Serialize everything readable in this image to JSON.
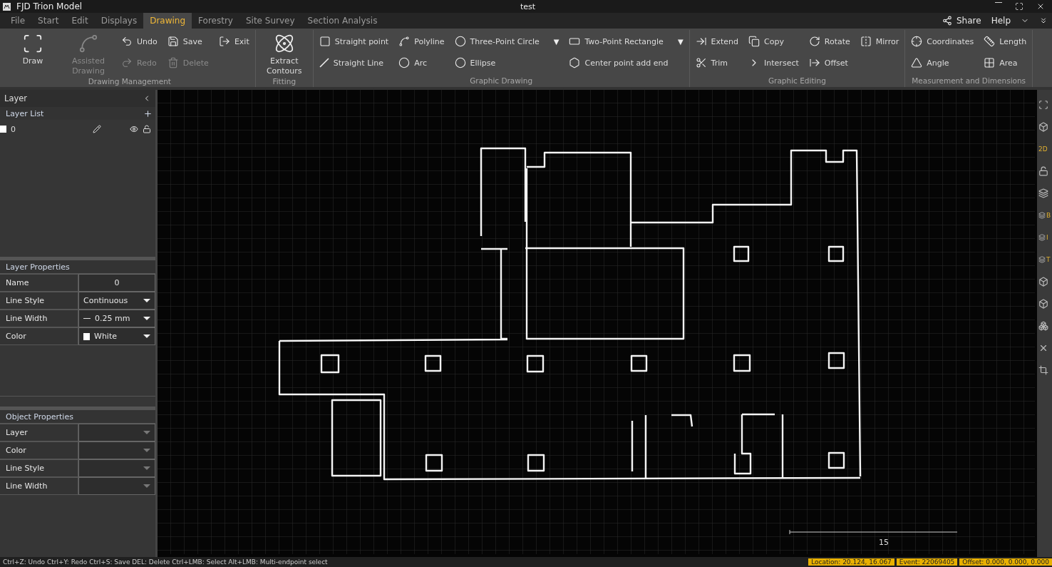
{
  "window": {
    "title": "FJD Trion Model",
    "document": "test"
  },
  "menu_tabs": [
    {
      "label": "File",
      "selected": false
    },
    {
      "label": "Start",
      "selected": false
    },
    {
      "label": "Edit",
      "selected": false
    },
    {
      "label": "Displays",
      "selected": false
    },
    {
      "label": "Drawing",
      "selected": true
    },
    {
      "label": "Forestry",
      "selected": false
    },
    {
      "label": "Site Survey",
      "selected": false
    },
    {
      "label": "Section Analysis",
      "selected": false
    }
  ],
  "top_right": {
    "share": "Share",
    "help": "Help"
  },
  "ribbon": [
    {
      "label": "Drawing Management",
      "columns": [
        [
          {
            "label": "Draw",
            "kind": "large",
            "disabled": false
          }
        ],
        [
          {
            "label": "Assisted Drawing",
            "kind": "large",
            "disabled": true
          }
        ],
        [
          {
            "label": "Undo",
            "kind": "small",
            "disabled": false
          },
          {
            "label": "Redo",
            "kind": "small",
            "disabled": true
          }
        ],
        [
          {
            "label": "Save",
            "kind": "small",
            "disabled": false
          },
          {
            "label": "Delete",
            "kind": "small",
            "disabled": true
          }
        ],
        [
          {
            "label": "Exit",
            "kind": "small",
            "disabled": false
          }
        ]
      ]
    },
    {
      "label": "Fitting",
      "columns": [
        [
          {
            "label": "Extract Contours",
            "kind": "large",
            "disabled": false
          }
        ]
      ]
    },
    {
      "label": "Graphic Drawing",
      "columns": [
        [
          {
            "label": "Straight point",
            "kind": "small",
            "disabled": false
          },
          {
            "label": "Straight Line",
            "kind": "small",
            "disabled": false
          }
        ],
        [
          {
            "label": "Polyline",
            "kind": "small",
            "disabled": false
          },
          {
            "label": "Arc",
            "kind": "small",
            "disabled": false
          }
        ],
        [
          {
            "label": "Three-Point Circle",
            "kind": "small",
            "disabled": false,
            "dropdown": "▼"
          },
          {
            "label": "Ellipse",
            "kind": "small",
            "disabled": false
          }
        ],
        [
          {
            "label": "Two-Point Rectangle",
            "kind": "small",
            "disabled": false,
            "dropdown": "▼"
          },
          {
            "label": "Center point add end",
            "kind": "small",
            "disabled": false
          }
        ]
      ]
    },
    {
      "label": "Graphic Editing",
      "columns": [
        [
          {
            "label": "Extend",
            "kind": "small",
            "disabled": false
          },
          {
            "label": "Trim",
            "kind": "small",
            "disabled": false
          }
        ],
        [
          {
            "label": "Copy",
            "kind": "small",
            "disabled": false
          },
          {
            "label": "Intersect",
            "kind": "small",
            "disabled": false
          }
        ],
        [
          {
            "label": "Rotate",
            "kind": "small",
            "disabled": false
          },
          {
            "label": "Offset",
            "kind": "small",
            "disabled": false
          }
        ],
        [
          {
            "label": "Mirror",
            "kind": "small",
            "disabled": false
          }
        ]
      ]
    },
    {
      "label": "Measurement and Dimensions",
      "columns": [
        [
          {
            "label": "Coordinates",
            "kind": "small",
            "disabled": false
          },
          {
            "label": "Angle",
            "kind": "small",
            "disabled": false
          }
        ],
        [
          {
            "label": "Length",
            "kind": "small",
            "disabled": false
          },
          {
            "label": "Area",
            "kind": "small",
            "disabled": false
          }
        ]
      ]
    }
  ],
  "layer_panel": {
    "title": "Layer",
    "list_title": "Layer List",
    "layers": [
      {
        "name": "0",
        "visible": true,
        "locked": false
      }
    ],
    "properties_title": "Layer Properties",
    "properties": [
      {
        "label": "Name",
        "value": "0",
        "kind": "text"
      },
      {
        "label": "Line Style",
        "value": "Continuous",
        "kind": "select"
      },
      {
        "label": "Line Width",
        "value": "0.25 mm",
        "kind": "width"
      },
      {
        "label": "Color",
        "value": "White",
        "kind": "color",
        "color": "#ffffff"
      }
    ],
    "object_title": "Object Properties",
    "object_properties": [
      {
        "label": "Layer"
      },
      {
        "label": "Color"
      },
      {
        "label": "Line Style"
      },
      {
        "label": "Line Width"
      }
    ]
  },
  "canvas": {
    "scale_label": "15"
  },
  "right_toolbar": [
    {
      "kind": "icon"
    },
    {
      "kind": "icon"
    },
    {
      "kind": "text",
      "label": "2D"
    },
    {
      "kind": "icon"
    },
    {
      "kind": "icon"
    },
    {
      "kind": "labeled",
      "label": "B"
    },
    {
      "kind": "labeled",
      "label": "I"
    },
    {
      "kind": "labeled",
      "label": "T"
    },
    {
      "kind": "icon"
    },
    {
      "kind": "icon"
    },
    {
      "kind": "icon"
    },
    {
      "kind": "icon"
    },
    {
      "kind": "icon"
    }
  ],
  "status_bar": {
    "hint": "Ctrl+Z: Undo Ctrl+Y: Redo Ctrl+S: Save DEL: Delete Ctrl+LMB: Select Alt+LMB: Multi-endpoint select",
    "fields": [
      "Location: 20.124, 16.067",
      "Event: 22069405",
      "Offset: 0.000, 0.000, 0.000"
    ]
  }
}
